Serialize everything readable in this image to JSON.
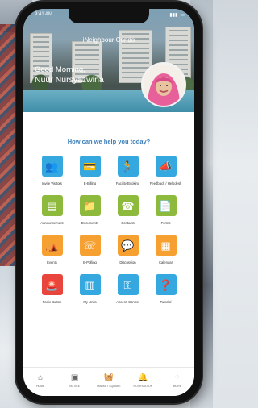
{
  "status": {
    "time": "9:41 AM",
    "signal": "▮▮▮",
    "battery": "▭"
  },
  "condo_title": "iNeighbour Condo",
  "greeting": "Good Morning,",
  "user_name": "Nuur Nursyazwina",
  "help_prompt": "How can we help you today?",
  "colors": {
    "blue": "#35a8e0",
    "green": "#8dba3c",
    "orange": "#f5a031",
    "red": "#e8463d",
    "prompt": "#3d7fb8"
  },
  "services": [
    {
      "label": "Invite Visitors",
      "icon": "visitors-icon",
      "glyph": "👥",
      "color": "#35a8e0"
    },
    {
      "label": "E-Billing",
      "icon": "ebilling-icon",
      "glyph": "💳",
      "color": "#35a8e0"
    },
    {
      "label": "Facility Booking",
      "icon": "facility-icon",
      "glyph": "🏃",
      "color": "#35a8e0"
    },
    {
      "label": "Feedback / Helpdesk",
      "icon": "feedback-icon",
      "glyph": "📣",
      "color": "#35a8e0"
    },
    {
      "label": "Announcement",
      "icon": "announcement-icon",
      "glyph": "▤",
      "color": "#8dba3c"
    },
    {
      "label": "Documents",
      "icon": "documents-icon",
      "glyph": "📁",
      "color": "#8dba3c"
    },
    {
      "label": "Contacts",
      "icon": "contacts-icon",
      "glyph": "☎",
      "color": "#8dba3c"
    },
    {
      "label": "Forms",
      "icon": "forms-icon",
      "glyph": "📄",
      "color": "#8dba3c"
    },
    {
      "label": "Events",
      "icon": "events-icon",
      "glyph": "⛺",
      "color": "#f5a031"
    },
    {
      "label": "E-Polling",
      "icon": "epolling-icon",
      "glyph": "☏",
      "color": "#f5a031"
    },
    {
      "label": "Discussion",
      "icon": "discussion-icon",
      "glyph": "💬",
      "color": "#f5a031"
    },
    {
      "label": "Calendar",
      "icon": "calendar-icon",
      "glyph": "▦",
      "color": "#f5a031"
    },
    {
      "label": "Panic Button",
      "icon": "panic-icon",
      "glyph": "🚨",
      "color": "#e8463d"
    },
    {
      "label": "My Units",
      "icon": "units-icon",
      "glyph": "▥",
      "color": "#35a8e0"
    },
    {
      "label": "Access Control",
      "icon": "access-icon",
      "glyph": "⚿",
      "color": "#35a8e0"
    },
    {
      "label": "Tutorial",
      "icon": "tutorial-icon",
      "glyph": "❓",
      "color": "#35a8e0"
    }
  ],
  "tabs": [
    {
      "label": "HOME",
      "icon": "home-icon",
      "glyph": "⌂"
    },
    {
      "label": "NOTICE",
      "icon": "notice-icon",
      "glyph": "▣"
    },
    {
      "label": "MARKET SQUARE",
      "icon": "market-icon",
      "glyph": "🧺"
    },
    {
      "label": "NOTIFICATION",
      "icon": "notification-icon",
      "glyph": "🔔"
    },
    {
      "label": "MORE",
      "icon": "more-icon",
      "glyph": "⁘"
    }
  ]
}
